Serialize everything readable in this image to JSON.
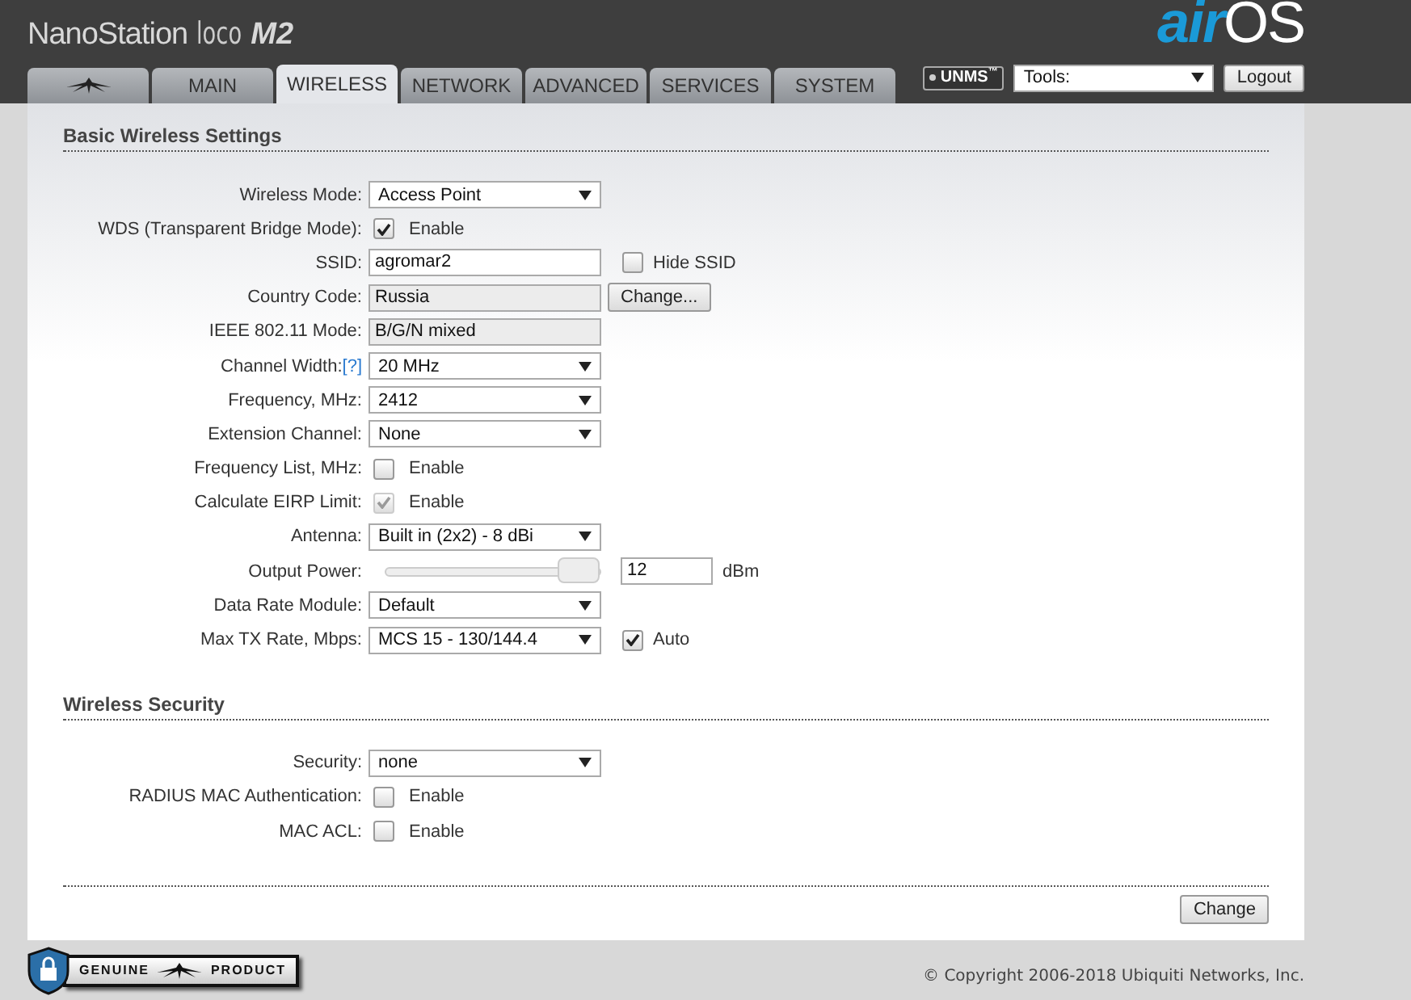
{
  "header": {
    "brand": {
      "name": "NanoStation",
      "variant": "loco",
      "model": "M2"
    },
    "logo": {
      "prefix": "air",
      "suffix": "OS"
    }
  },
  "tabs": [
    {
      "kind": "icon",
      "selected": false
    },
    {
      "kind": "text",
      "label": "MAIN",
      "selected": false
    },
    {
      "kind": "text",
      "label": "WIRELESS",
      "selected": true
    },
    {
      "kind": "text",
      "label": "NETWORK",
      "selected": false
    },
    {
      "kind": "text",
      "label": "ADVANCED",
      "selected": false
    },
    {
      "kind": "text",
      "label": "SERVICES",
      "selected": false
    },
    {
      "kind": "text",
      "label": "SYSTEM",
      "selected": false
    }
  ],
  "toolbar": {
    "badge": "UNMS$^{™}$",
    "tools": "Tools:",
    "logout": "Logout"
  },
  "sections": [
    {
      "title": "Basic Wireless Settings",
      "rows": [
        {
          "label": "Wireless Mode:",
          "kind": "select",
          "value": "Access Point"
        },
        {
          "label": "WDS (Transparent Bridge Mode):",
          "kind": "checkbox",
          "checked": true,
          "disabled": false,
          "text": "Enable"
        },
        {
          "label": "SSID:",
          "kind": "text",
          "value": "agromar2",
          "extra": {
            "kind": "checkbox",
            "checked": false,
            "text": "Hide SSID"
          }
        },
        {
          "label": "Country Code:",
          "kind": "readonly",
          "value": "Russia",
          "extra": {
            "kind": "button",
            "text": "Change..."
          }
        },
        {
          "label": "IEEE 802.11 Mode:",
          "kind": "readonly",
          "value": "B/G/N mixed"
        },
        {
          "label": "Channel Width:",
          "help": "[?]",
          "kind": "select",
          "value": "20 MHz"
        },
        {
          "label": "Frequency, MHz:",
          "kind": "select",
          "value": "2412"
        },
        {
          "label": "Extension Channel:",
          "kind": "select",
          "value": "None"
        },
        {
          "label": "Frequency List, MHz:",
          "kind": "checkbox",
          "checked": false,
          "disabled": false,
          "text": "Enable"
        },
        {
          "label": "Calculate EIRP Limit:",
          "kind": "checkbox",
          "checked": true,
          "disabled": true,
          "text": "Enable"
        },
        {
          "label": "Antenna:",
          "kind": "select",
          "value": "Built in (2x2) - 8 dBi"
        },
        {
          "label": "Output Power:",
          "kind": "slider",
          "level": 1,
          "value": "12",
          "unit": "dBm"
        },
        {
          "label": "Data Rate Module:",
          "kind": "select",
          "value": "Default"
        },
        {
          "label": "Max TX Rate, Mbps:",
          "kind": "select",
          "value": "MCS 15 - 130/144.4",
          "extra": {
            "kind": "checkbox",
            "checked": true,
            "text": "Auto"
          }
        }
      ]
    },
    {
      "title": "Wireless Security",
      "rows": [
        {
          "label": "Security:",
          "kind": "select",
          "value": "none"
        },
        {
          "label": "RADIUS MAC Authentication:",
          "kind": "checkbox",
          "checked": false,
          "disabled": false,
          "text": "Enable"
        },
        {
          "label": "MAC ACL:",
          "kind": "checkbox",
          "checked": false,
          "disabled": false,
          "text": "Enable"
        }
      ]
    }
  ],
  "actions": {
    "change": "Change"
  },
  "footer": {
    "badge": {
      "left": "GENUINE",
      "right": "PRODUCT"
    },
    "copyright": "© Copyright 2006-2018 Ubiquiti Networks, Inc."
  }
}
